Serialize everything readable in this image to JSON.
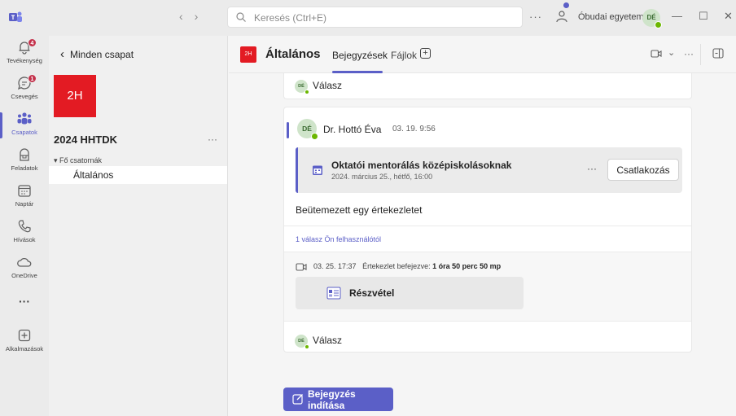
{
  "titlebar": {
    "search_placeholder": "Keresés (Ctrl+E)",
    "more": "···",
    "org_name": "Óbudai egyetem",
    "avatar_initials": "DÉ",
    "minimize": "—",
    "maximize": "☐",
    "close": "✕",
    "back": "‹",
    "forward": "›"
  },
  "rail": {
    "items": [
      {
        "label": "Tevékenység",
        "badge": "4"
      },
      {
        "label": "Csevegés",
        "badge": "1"
      },
      {
        "label": "Csapatok"
      },
      {
        "label": "Feladatok"
      },
      {
        "label": "Naptár"
      },
      {
        "label": "Hívások"
      },
      {
        "label": "OneDrive"
      },
      {
        "label": "···"
      },
      {
        "label": "Alkalmazások"
      }
    ],
    "active": "Csapatok"
  },
  "team_pane": {
    "back_label": "Minden csapat",
    "back_chevron": "‹",
    "team_initials": "2H",
    "team_name": "2024 HHTDK",
    "team_more": "···",
    "channel_group": "▾ Fő csatornák",
    "channels": [
      {
        "label": "Általános",
        "selected": true
      }
    ]
  },
  "header": {
    "team_initials": "2H",
    "channel_title": "Általános",
    "tabs": [
      {
        "label": "Bejegyzések",
        "active": true
      },
      {
        "label": "Fájlok",
        "active": false
      }
    ],
    "add_tab": "+",
    "video_menu": "⌄",
    "more": "···"
  },
  "feed": {
    "top_reply": {
      "avatar_initials": "DÉ",
      "label": "Válasz"
    },
    "post": {
      "avatar_initials": "DÉ",
      "author": "Dr. Hottó Éva",
      "time": "03. 19. 9:56",
      "meeting": {
        "title": "Oktatói mentorálás középiskolásoknak",
        "date": "2024. március 25., hétfő, 16:00",
        "more": "···",
        "join_label": "Csatlakozás"
      },
      "text": "Beütemezett egy értekezletet",
      "reply_count": "1 válasz Ön felhasználótól",
      "recap": {
        "time": "03. 25. 17:37",
        "ended_label": "Értekezlet befejezve:",
        "duration": "1 óra 50 perc 50 mp",
        "attachment_label": "Részvétel"
      },
      "reply": {
        "avatar_initials": "DÉ",
        "label": "Válasz"
      }
    },
    "new_post_label": "Bejegyzés indítása"
  },
  "colors": {
    "accent": "#5b5fc7",
    "team_tile": "#e31b23",
    "badge": "#c4314b",
    "presence": "#6bb700"
  }
}
